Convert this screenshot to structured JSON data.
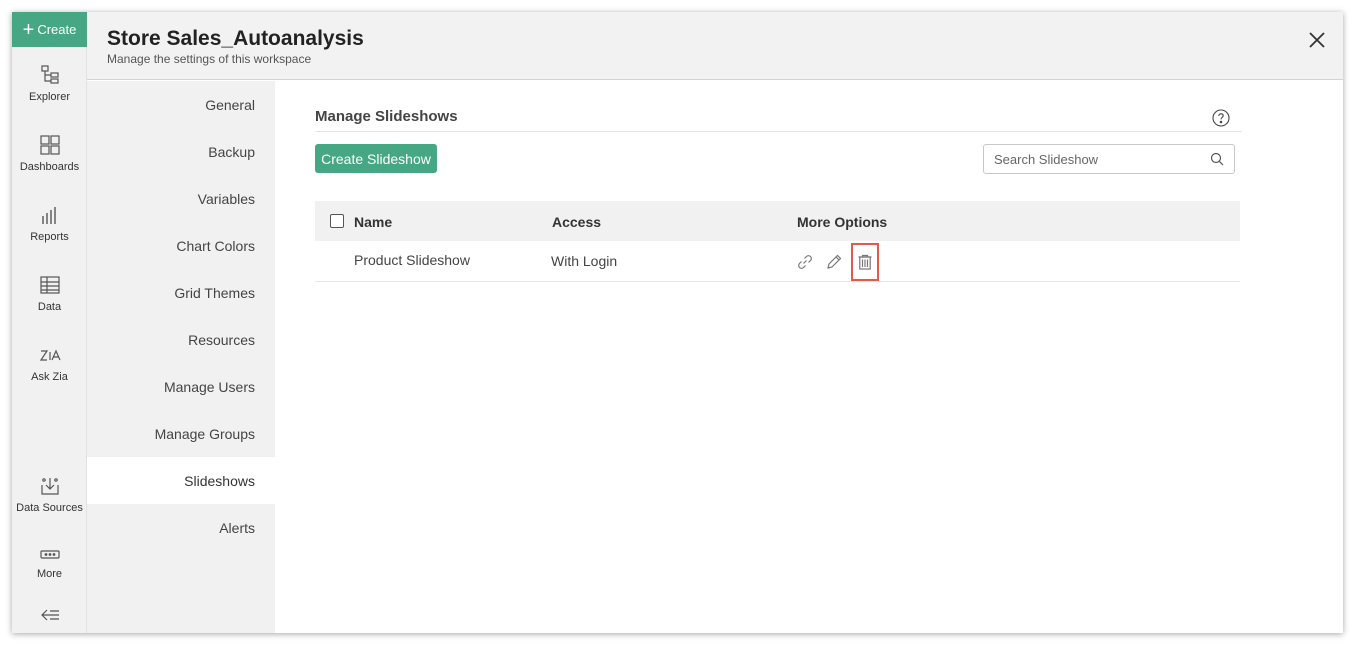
{
  "app": {
    "create_label": "Create"
  },
  "rail": {
    "items": [
      {
        "label": "Explorer",
        "icon": "explorer-icon"
      },
      {
        "label": "Dashboards",
        "icon": "dashboards-icon"
      },
      {
        "label": "Reports",
        "icon": "reports-icon"
      },
      {
        "label": "Data",
        "icon": "data-icon"
      },
      {
        "label": "Ask Zia",
        "icon": "ask-zia-icon"
      },
      {
        "label": "Data Sources",
        "icon": "data-sources-icon"
      },
      {
        "label": "More",
        "icon": "more-icon"
      }
    ]
  },
  "header": {
    "title": "Store Sales_Autoanalysis",
    "subtitle": "Manage the settings of this workspace"
  },
  "settings_nav": {
    "items": [
      {
        "label": "General"
      },
      {
        "label": "Backup"
      },
      {
        "label": "Variables"
      },
      {
        "label": "Chart Colors"
      },
      {
        "label": "Grid Themes"
      },
      {
        "label": "Resources"
      },
      {
        "label": "Manage Users"
      },
      {
        "label": "Manage Groups"
      },
      {
        "label": "Slideshows",
        "active": true
      },
      {
        "label": "Alerts"
      }
    ]
  },
  "main": {
    "section_title": "Manage Slideshows",
    "create_button": "Create Slideshow",
    "search_placeholder": "Search Slideshow",
    "table": {
      "columns": [
        "Name",
        "Access",
        "More Options"
      ],
      "rows": [
        {
          "name": "Product Slideshow",
          "access": "With Login"
        }
      ]
    }
  },
  "colors": {
    "accent": "#46a784",
    "highlight": "#e25b4a"
  }
}
